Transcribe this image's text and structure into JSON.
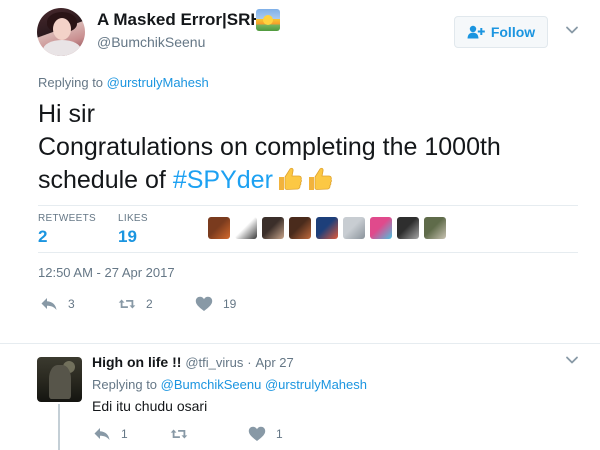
{
  "tweet": {
    "author_name": "A Masked Error|SRH",
    "author_emoji_icon": "sunrise-emoji-icon",
    "handle": "@BumchikSeenu",
    "follow_label": "Follow",
    "replying_prefix": "Replying to",
    "replying_to": "@urstrulyMahesh",
    "text_line1": "Hi sir",
    "text_line2": "Congratulations on completing the 1000th",
    "text_line3_prefix": "schedule of ",
    "hashtag": "#SPYder",
    "trailing_emoji_icons": [
      "thumbs-up-emoji-icon",
      "thumbs-up-emoji-icon"
    ],
    "retweets_label": "RETWEETS",
    "retweets_count": "2",
    "likes_label": "LIKES",
    "likes_count": "19",
    "likers_count": 9,
    "timestamp": "12:50 AM - 27 Apr 2017",
    "actions": {
      "reply_count": "3",
      "retweet_count": "2",
      "like_count": "19"
    }
  },
  "reply": {
    "name": "High on life !!",
    "handle": "@tfi_virus",
    "separator": "·",
    "date": "Apr 27",
    "replying_prefix": "Replying to",
    "replying_to_1": "@BumchikSeenu",
    "replying_to_2": "@urstrulyMahesh",
    "text": "Edi itu chudu osari",
    "actions": {
      "reply_count": "1",
      "like_count": "1"
    }
  },
  "colors": {
    "link": "#1b95e0",
    "muted": "#657786",
    "text": "#14171a",
    "divider": "#e6ecf0"
  }
}
